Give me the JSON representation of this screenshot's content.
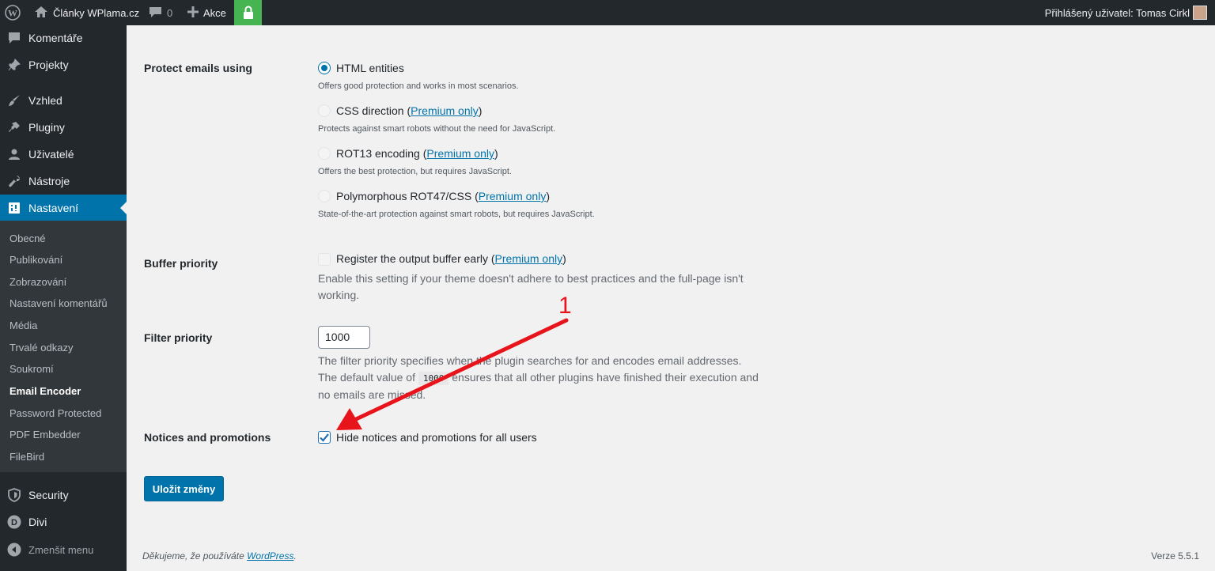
{
  "admin_bar": {
    "site_name": "Články WPlama.cz",
    "comments_count": "0",
    "new_label": "Akce",
    "user_greeting": "Přihlášený uživatel: Tomas Cirkl"
  },
  "sidebar": {
    "items": [
      {
        "label": "Komentáře",
        "icon": "comment-icon"
      },
      {
        "label": "Projekty",
        "icon": "pin-icon"
      },
      {
        "label": "Vzhled",
        "icon": "brush-icon"
      },
      {
        "label": "Pluginy",
        "icon": "plugin-icon"
      },
      {
        "label": "Uživatelé",
        "icon": "user-icon"
      },
      {
        "label": "Nástroje",
        "icon": "wrench-icon"
      },
      {
        "label": "Nastavení",
        "icon": "settings-icon"
      }
    ],
    "submenu": [
      "Obecné",
      "Publikování",
      "Zobrazování",
      "Nastavení komentářů",
      "Média",
      "Trvalé odkazy",
      "Soukromí",
      "Email Encoder",
      "Password Protected",
      "PDF Embedder",
      "FileBird"
    ],
    "bottom_items": [
      {
        "label": "Security",
        "icon": "shield-icon"
      },
      {
        "label": "Divi",
        "icon": "divi-icon"
      },
      {
        "label": "Zmenšit menu",
        "icon": "collapse-icon"
      }
    ]
  },
  "settings": {
    "protect_label": "Protect emails using",
    "options": [
      {
        "label": "HTML entities",
        "premium": "",
        "desc": "Offers good protection and works in most scenarios."
      },
      {
        "label": "CSS direction (",
        "premium": "Premium only",
        "desc": "Protects against smart robots without the need for JavaScript."
      },
      {
        "label": "ROT13 encoding (",
        "premium": "Premium only",
        "desc": "Offers the best protection, but requires JavaScript."
      },
      {
        "label": "Polymorphous ROT47/CSS (",
        "premium": "Premium only",
        "desc": "State-of-the-art protection against smart robots, but requires JavaScript."
      }
    ],
    "buffer_label": "Buffer priority",
    "buffer_option": "Register the output buffer early (",
    "buffer_premium": "Premium only",
    "buffer_desc": "Enable this setting if your theme doesn't adhere to best practices and the full-page isn't working.",
    "filter_label": "Filter priority",
    "filter_value": "1000",
    "filter_desc_1": "The filter priority specifies when the plugin searches for and encodes email addresses. The default value of",
    "filter_code": "1000",
    "filter_desc_2": "ensures that all other plugins have finished their execution and no emails are missed.",
    "notices_label": "Notices and promotions",
    "notices_option": "Hide notices and promotions for all users",
    "save_label": "Uložit změny"
  },
  "annotation": {
    "number": "1",
    "color": "#e8141b"
  },
  "footer": {
    "thanks_prefix": "Děkujeme, že používáte",
    "thanks_link": "WordPress",
    "version": "Verze 5.5.1"
  },
  "colors": {
    "accent": "#0073aa",
    "adminbar": "#23282d",
    "lock_green": "#46b450"
  }
}
